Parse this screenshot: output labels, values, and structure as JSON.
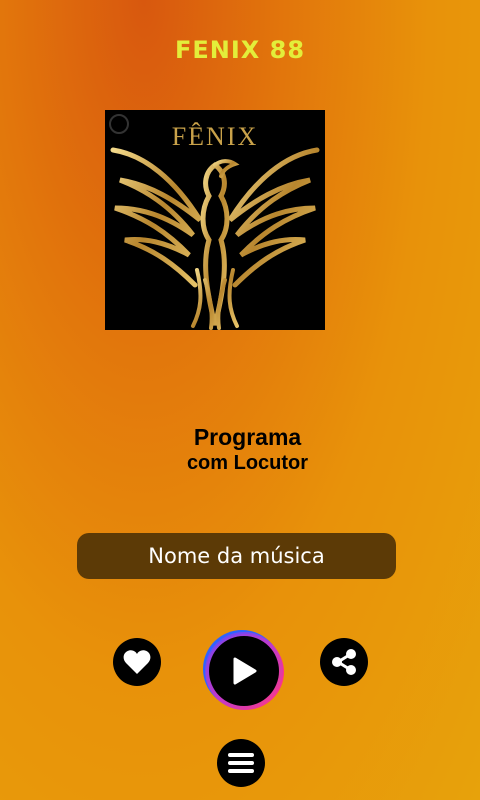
{
  "app": {
    "title": "FENIX 88"
  },
  "cover": {
    "logo_text": "FÊNIX",
    "accent_color": "#c9a24a"
  },
  "program": {
    "line1": "Programa",
    "line2": "com Locutor"
  },
  "song": {
    "name": "Nome da música"
  },
  "controls": {
    "like_icon": "heart-icon",
    "play_icon": "play-icon",
    "share_icon": "share-icon",
    "menu_icon": "menu-icon"
  },
  "colors": {
    "title": "#e3ee3a",
    "song_bar": "#5c3a06",
    "play_ring_blue": "#2e62ff",
    "play_ring_pink": "#ff2f8f"
  }
}
